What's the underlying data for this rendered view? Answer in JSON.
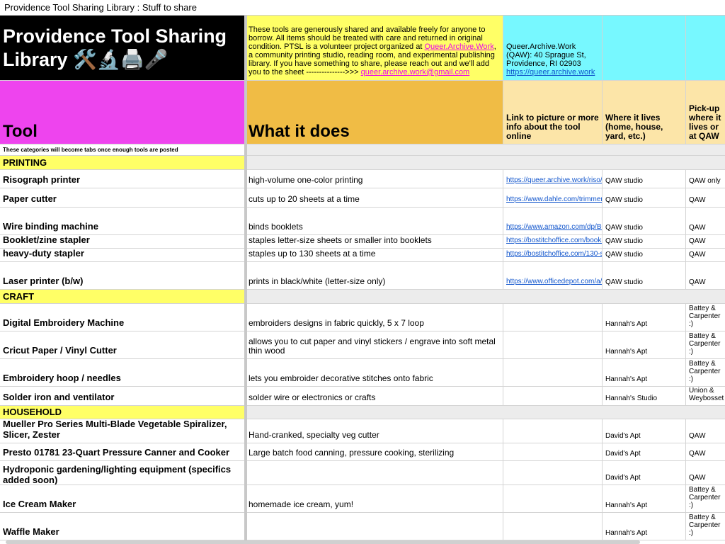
{
  "window": {
    "title": "Providence Tool Sharing Library : Stuff to share"
  },
  "header": {
    "title": "Providence Tool Sharing Library 🛠️🔬🖨️🎤",
    "description": "These tools are generously shared and available freely for anyone to borrow. All items should be treated with care and returned in original condition. PTSL is a volunteer project organized at ",
    "org_link": "Queer.Archive.Work",
    "description2": ", a community printing studio, reading room, and experimental publishing library. If you have something to share, please reach out and we'll add you to the sheet --------------->>> ",
    "email_link": "queer.archive.work@gmail.com",
    "address": "Queer.Archive.Work (QAW): 40 Sprague St, Providence, RI 02903",
    "address_link": "https://queer.archive.work"
  },
  "columns": {
    "tool": "Tool",
    "what": "What it does",
    "link": "Link to picture or more info about the tool online",
    "where": "Where it lives (home, house, yard, etc.)",
    "pickup": "Pick-up where it lives or at QAW"
  },
  "note": "These categories will become tabs once enough tools are posted",
  "categories": {
    "printing": "PRINTING",
    "craft": "CRAFT",
    "household": "HOUSEHOLD"
  },
  "rows": [
    {
      "tool": "Risograph printer",
      "what": "high-volume one-color printing",
      "link": "https://queer.archive.work/riso/i",
      "where": "QAW studio",
      "pickup": "QAW only"
    },
    {
      "tool": "Paper cutter",
      "what": "cuts up to 20 sheets at a time",
      "link": "https://www.dahle.com/trimmer/",
      "where": "QAW studio",
      "pickup": "QAW"
    },
    {
      "tool": "Wire binding machine",
      "what": "binds booklets",
      "link": "https://www.amazon.com/dp/B0",
      "where": "QAW studio",
      "pickup": "QAW"
    },
    {
      "tool": "Booklet/zine stapler",
      "what": "staples letter-size sheets or smaller into booklets",
      "link": "https://bostitchoffice.com/booklet",
      "where": "QAW studio",
      "pickup": "QAW"
    },
    {
      "tool": "heavy-duty stapler",
      "what": "staples up to 130 sheets at a time",
      "link": "https://bostitchoffice.com/130-s",
      "where": "QAW studio",
      "pickup": "QAW"
    },
    {
      "tool": "Laser printer (b/w)",
      "what": "prints in black/white (letter-size only)",
      "link": "https://www.officedepot.com/a/p",
      "where": "QAW studio",
      "pickup": "QAW"
    },
    {
      "tool": "Digital Embroidery Machine",
      "what": "embroiders designs in fabric quickly, 5 x 7 loop",
      "link": "",
      "where": "Hannah's Apt",
      "pickup": "Hannah's porch Battey & Carpenter :)"
    },
    {
      "tool": "Cricut Paper / Vinyl Cutter",
      "what": "allows you to cut paper and vinyl stickers / engrave into soft metal thin wood",
      "link": "",
      "where": "Hannah's Apt",
      "pickup": "Hannah's porch Battey & Carpenter :)"
    },
    {
      "tool": "Embroidery hoop / needles",
      "what": "lets you embroider decorative stitches onto fabric",
      "link": "",
      "where": "Hannah's Apt",
      "pickup": "Hannah's porch Battey & Carpenter :)"
    },
    {
      "tool": "Solder iron and ventilator",
      "what": "solder wire or electronics or crafts",
      "link": "",
      "where": "Hannah's Studio",
      "pickup": "Union & Weybosset"
    },
    {
      "tool": "Mueller Pro Series Multi-Blade Vegetable Spiralizer, Slicer, Zester",
      "what": "Hand-cranked, specialty veg cutter",
      "link": "",
      "where": "David's Apt",
      "pickup": "QAW"
    },
    {
      "tool": "Presto 01781 23-Quart Pressure Canner and Cooker",
      "what": "Large batch food canning, pressure cooking, sterilizing",
      "link": "",
      "where": "David's Apt",
      "pickup": "QAW"
    },
    {
      "tool": "Hydroponic gardening/lighting equipment (specifics added soon)",
      "what": "",
      "link": "",
      "where": "David's Apt",
      "pickup": "QAW"
    },
    {
      "tool": "Ice Cream Maker",
      "what": "homemade ice cream, yum!",
      "link": "",
      "where": "Hannah's Apt",
      "pickup": "Hannah's porch Battey & Carpenter :)"
    },
    {
      "tool": "Waffle Maker",
      "what": "",
      "link": "",
      "where": "Hannah's Apt",
      "pickup": "Hannah's porch Battey & Carpenter :)"
    }
  ]
}
